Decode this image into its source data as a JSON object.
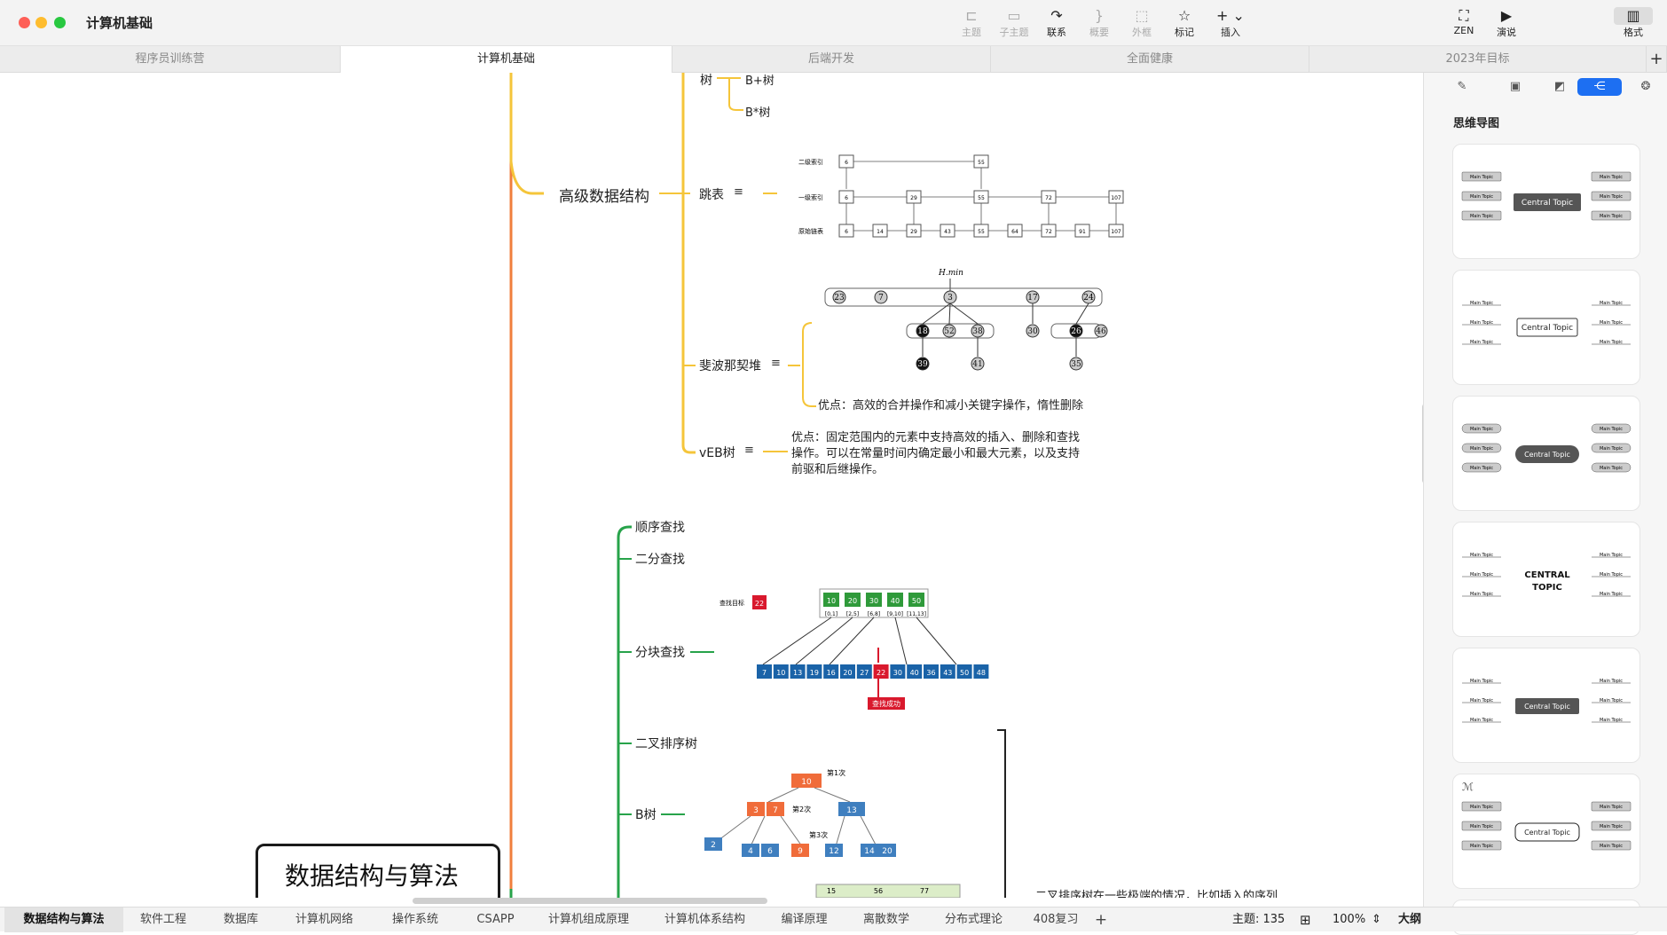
{
  "window": {
    "title": "计算机基础"
  },
  "toolbar": {
    "topic": "主题",
    "subtopic": "子主题",
    "relation": "联系",
    "summary": "概要",
    "boundary": "外框",
    "marker": "标记",
    "insert": "插入",
    "zen": "ZEN",
    "pitch": "演说",
    "format": "格式"
  },
  "doc_tabs": [
    "程序员训练营",
    "计算机基础",
    "后端开发",
    "全面健康",
    "2023年目标"
  ],
  "mindmap": {
    "central": "数据结构与算法",
    "advanced": {
      "label": "高级数据结构",
      "tree": "树",
      "bplus": "B+树",
      "bstar": "B*树",
      "skiplist": "跳表",
      "fibheap": "斐波那契堆",
      "fib_note": "优点：高效的合并操作和减小关键字操作，惰性删除",
      "veb": "vEB树",
      "veb_note_1": "优点：固定范围内的元素中支持高效的插入、删除和查找",
      "veb_note_2": "操作。可以在常量时间内确定最小和最大元素，以及支持",
      "veb_note_3": "前驱和后继操作。"
    },
    "search": {
      "sequential": "顺序查找",
      "binary": "二分查找",
      "block": "分块查找",
      "bst": "二叉排序树",
      "btree": "B树",
      "bst_note_partial": "二叉排序树在一些极端的情况，比如插入的序列"
    },
    "skiplist_img": {
      "level2": "二级索引",
      "level1": "一级索引",
      "base": "原始链表",
      "l2": [
        "6",
        "55"
      ],
      "l1": [
        "6",
        "29",
        "55",
        "72",
        "107"
      ],
      "l0": [
        "6",
        "14",
        "29",
        "43",
        "55",
        "64",
        "72",
        "91",
        "107"
      ]
    },
    "fib_img": {
      "hmin": "H.min",
      "roots": [
        "23",
        "7",
        "3",
        "17",
        "24"
      ],
      "children": [
        "18",
        "52",
        "38",
        "30",
        "26",
        "46"
      ],
      "grand": [
        "39",
        "41",
        "35"
      ]
    },
    "block_img": {
      "target_label": "查找目标",
      "target": "22",
      "index": [
        "10",
        "20",
        "30",
        "40",
        "50"
      ],
      "ranges": [
        "[0,1]",
        "[2,5]",
        "[6,8]",
        "[9,10]",
        "[11,13]"
      ],
      "array": [
        "7",
        "10",
        "13",
        "19",
        "16",
        "20",
        "27",
        "22",
        "30",
        "40",
        "36",
        "43",
        "50",
        "48"
      ],
      "found": "查找成功"
    },
    "btree_img": {
      "root": "10",
      "l1": [
        "3",
        "7"
      ],
      "l1r": "13",
      "leaves": [
        "2",
        "4",
        "6",
        "9",
        "12",
        "14",
        "20"
      ],
      "step1": "第1次",
      "step2": "第2次",
      "step3": "第3次",
      "bottom": [
        "15",
        "56",
        "77"
      ]
    }
  },
  "panel": {
    "title": "思维导图",
    "main_topic": "Main Topic",
    "central_topic": "Central Topic",
    "central_caps_1": "CENTRAL",
    "central_caps_2": "TOPIC"
  },
  "sheets": [
    "数据结构与算法",
    "软件工程",
    "数据库",
    "计算机网络",
    "操作系统",
    "CSAPP",
    "计算机组成原理",
    "计算机体系结构",
    "编译原理",
    "离散数学",
    "分布式理论",
    "408复习"
  ],
  "status": {
    "topics": "主题: 135",
    "zoom": "100%",
    "outline": "大纲"
  },
  "colors": {
    "orange": "#f07f3c",
    "yellow": "#f5c53a",
    "green": "#27a34a",
    "accent": "#1d6ff2"
  }
}
